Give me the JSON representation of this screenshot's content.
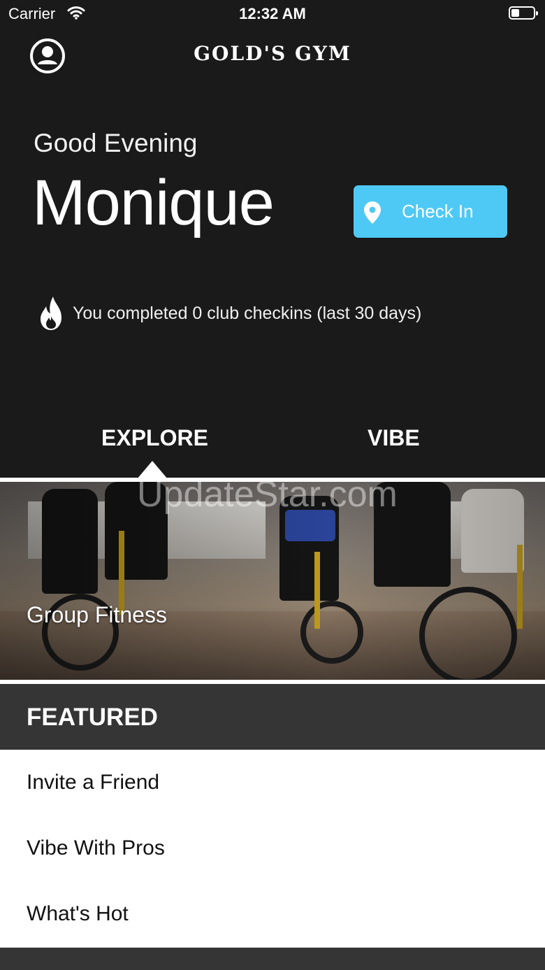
{
  "status_bar": {
    "carrier": "Carrier",
    "time": "12:32 AM"
  },
  "header": {
    "logo_text": "GOLD'S GYM"
  },
  "greeting": {
    "salutation": "Good Evening",
    "name": "Monique"
  },
  "check_in": {
    "label": "Check In",
    "color": "#4ec9f5"
  },
  "streak": {
    "text": "You completed 0 club checkins (last 30 days)"
  },
  "tabs": [
    {
      "label": "EXPLORE",
      "selected": true
    },
    {
      "label": "VIBE",
      "selected": false
    }
  ],
  "hero": {
    "title": "Group Fitness",
    "watermark": "UpdateStar.com"
  },
  "featured": {
    "header": "FEATURED",
    "items": [
      {
        "label": "Invite a Friend"
      },
      {
        "label": "Vibe With Pros"
      },
      {
        "label": "What's Hot"
      }
    ]
  }
}
